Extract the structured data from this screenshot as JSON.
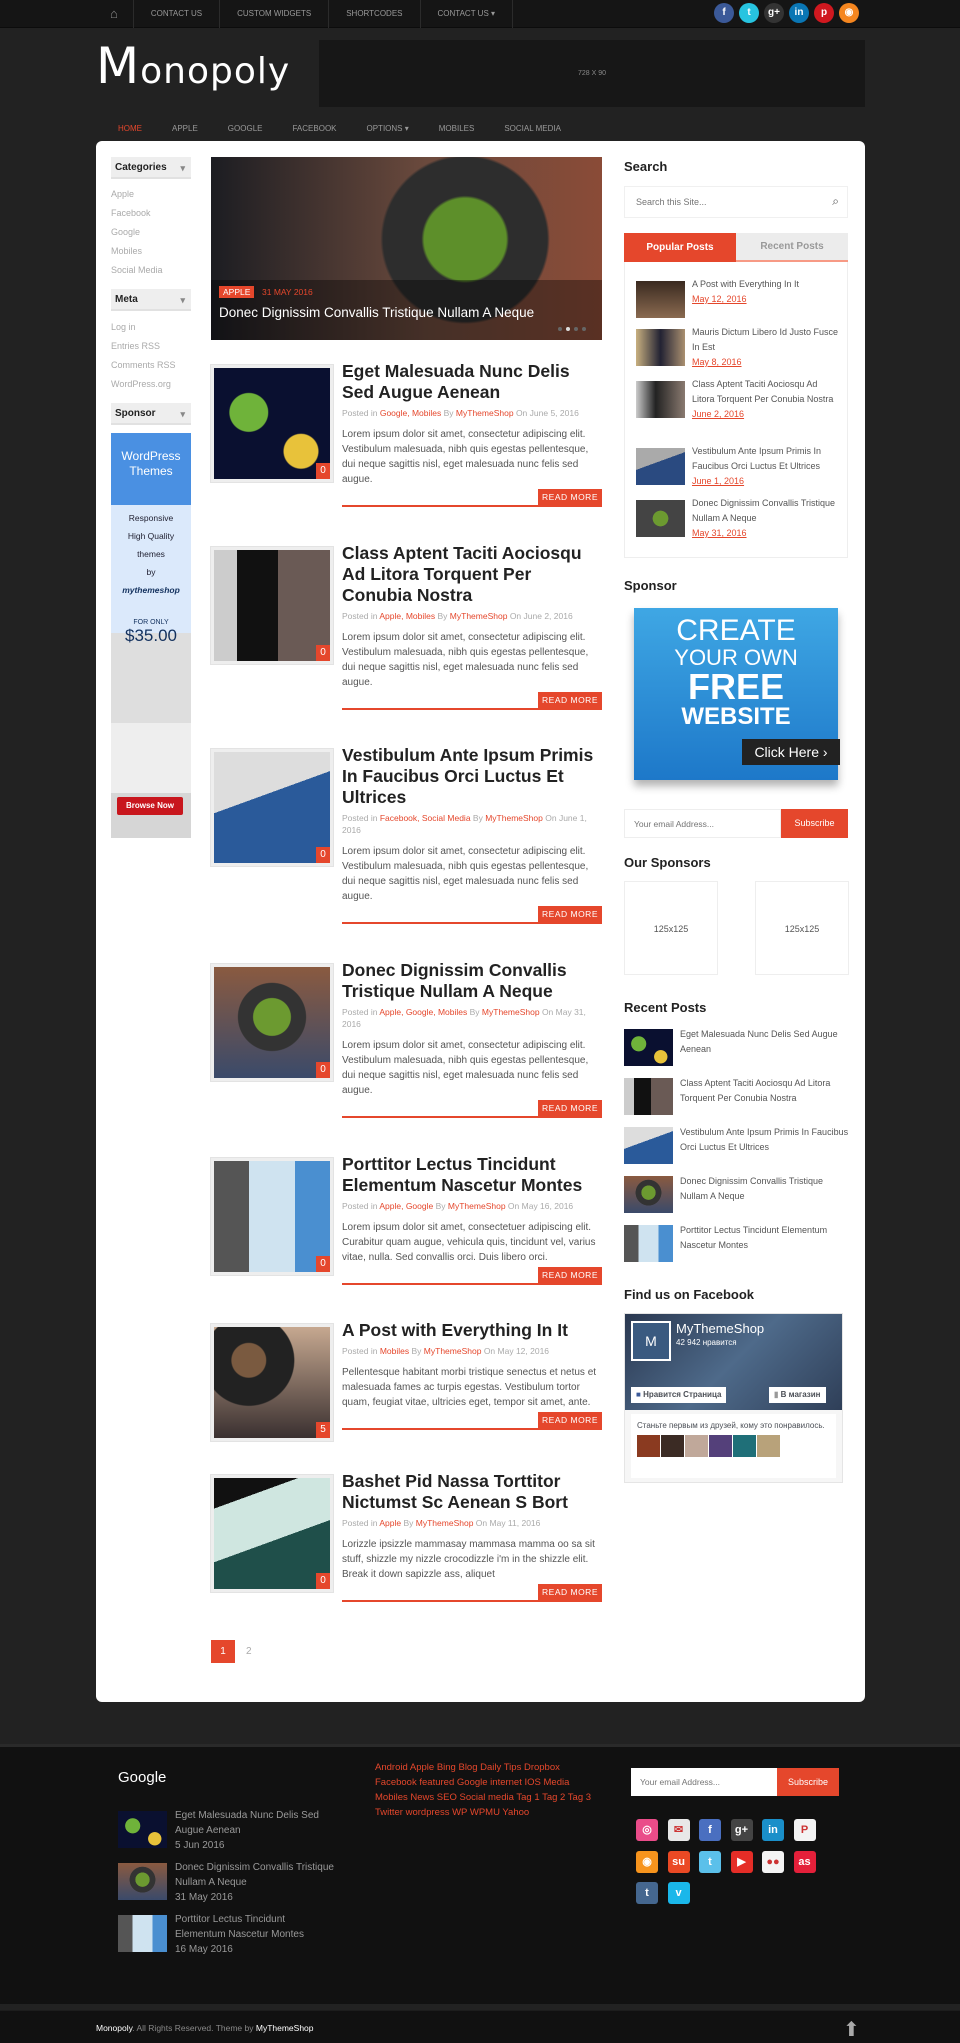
{
  "topbar": {
    "nav": [
      "CONTACT US",
      "CUSTOM WIDGETS",
      "SHORTCODES",
      "CONTACT US ▾"
    ],
    "social": [
      {
        "icon": "facebook-icon",
        "glyph": "f",
        "color": "#3b5998"
      },
      {
        "icon": "twitter-icon",
        "glyph": "t",
        "color": "#27c4e0"
      },
      {
        "icon": "google-plus-icon",
        "glyph": "g+",
        "color": "#333"
      },
      {
        "icon": "linkedin-icon",
        "glyph": "in",
        "color": "#0a76b4"
      },
      {
        "icon": "pinterest-icon",
        "glyph": "p",
        "color": "#d0181f"
      },
      {
        "icon": "rss-icon",
        "glyph": "◉",
        "color": "#f5861f"
      }
    ]
  },
  "header": {
    "logo_first": "M",
    "logo_rest": "onopoly",
    "ad": "728 X 90"
  },
  "mainnav": [
    "HOME",
    "APPLE",
    "GOOGLE",
    "FACEBOOK",
    "OPTIONS ▾",
    "MOBILES",
    "SOCIAL MEDIA"
  ],
  "left": {
    "categories_title": "Categories",
    "categories": [
      "Apple",
      "Facebook",
      "Google",
      "Mobiles",
      "Social Media"
    ],
    "meta_title": "Meta",
    "meta": [
      "Log in",
      "Entries RSS",
      "Comments RSS",
      "WordPress.org"
    ],
    "sponsor_title": "Sponsor",
    "banner": {
      "l1": "WordPress",
      "l2": "Themes",
      "l3": "Responsive",
      "l4": "High Quality",
      "l5": "themes",
      "l6": "by",
      "l7": "mythemeshop",
      "l8": "FOR ONLY",
      "l9": "$35.00",
      "l10": "Browse Now"
    }
  },
  "slider": {
    "category": "APPLE",
    "date": "31 MAY 2016",
    "title": "Donec Dignissim Convallis Tristique Nullam A Neque"
  },
  "posts": [
    {
      "title": "Eget Malesuada Nunc Delis Sed Augue Aenean",
      "cats": "Google, Mobiles",
      "author": "MyThemeShop",
      "date": "June 5, 2016",
      "excerpt": "Lorem ipsum dolor sit amet, consectetur adipiscing elit. Vestibulum malesuada, nibh quis egestas pellentesque, dui neque sagittis nisl, eget malesuada nunc felis sed augue.",
      "comments": "0"
    },
    {
      "title": "Class Aptent Taciti Aociosqu Ad Litora Torquent Per Conubia Nostra",
      "cats": "Apple, Mobiles",
      "author": "MyThemeShop",
      "date": "June 2, 2016",
      "excerpt": "Lorem ipsum dolor sit amet, consectetur adipiscing elit. Vestibulum malesuada, nibh quis egestas pellentesque, dui neque sagittis nisl, eget malesuada nunc felis sed augue.",
      "comments": "0"
    },
    {
      "title": "Vestibulum Ante Ipsum Primis In Faucibus Orci Luctus Et Ultrices",
      "cats": "Facebook, Social Media",
      "author": "MyThemeShop",
      "date": "June 1, 2016",
      "excerpt": "Lorem ipsum dolor sit amet, consectetur adipiscing elit. Vestibulum malesuada, nibh quis egestas pellentesque, dui neque sagittis nisl, eget malesuada nunc felis sed augue.",
      "comments": "0"
    },
    {
      "title": "Donec Dignissim Convallis Tristique Nullam A Neque",
      "cats": "Apple, Google, Mobiles",
      "author": "MyThemeShop",
      "date": "May 31, 2016",
      "excerpt": "Lorem ipsum dolor sit amet, consectetur adipiscing elit. Vestibulum malesuada, nibh quis egestas pellentesque, dui neque sagittis nisl, eget malesuada nunc felis sed augue.",
      "comments": "0"
    },
    {
      "title": "Porttitor Lectus Tincidunt Elementum Nascetur Montes",
      "cats": "Apple, Google",
      "author": "MyThemeShop",
      "date": "May 16, 2016",
      "excerpt": "Lorem ipsum dolor sit amet, consectetuer adipiscing elit. Curabitur quam augue, vehicula quis, tincidunt vel, varius vitae, nulla. Sed convallis orci. Duis libero orci.",
      "comments": "0"
    },
    {
      "title": "A Post with Everything In It",
      "cats": "Mobiles",
      "author": "MyThemeShop",
      "date": "May 12, 2016",
      "excerpt": "Pellentesque habitant morbi tristique senectus et netus et malesuada fames ac turpis egestas. Vestibulum tortor quam, feugiat vitae, ultricies eget, tempor sit amet, ante.",
      "comments": "5"
    },
    {
      "title": "Bashet Pid Nassa Torttitor Nictumst Sc Aenean S Bort",
      "cats": "Apple",
      "author": "MyThemeShop",
      "date": "May 11, 2016",
      "excerpt": "Lorizzle ipsizzle mammasay mammasa mamma oo sa sit stuff, shizzle my nizzle crocodizzle i'm in the shizzle elit. Break it down sapizzle ass, aliquet",
      "comments": "0"
    }
  ],
  "post_labels": {
    "posted_in": "Posted in",
    "by": "By",
    "on": "On",
    "read_more": "READ MORE"
  },
  "pagination": [
    "1",
    "2"
  ],
  "right": {
    "search_title": "Search",
    "search_placeholder": "Search this Site...",
    "tab_popular": "Popular Posts",
    "tab_recent": "Recent Posts",
    "popular": [
      {
        "title": "A Post with Everything In It",
        "date": "May 12, 2016"
      },
      {
        "title": "Mauris Dictum Libero Id Justo Fusce In Est",
        "date": "May 8, 2016"
      },
      {
        "title": "Class Aptent Taciti Aociosqu Ad Litora Torquent Per Conubia Nostra",
        "date": "June 2, 2016"
      },
      {
        "title": "Vestibulum Ante Ipsum Primis In Faucibus Orci Luctus Et Ultrices",
        "date": "June 1, 2016"
      },
      {
        "title": "Donec Dignissim Convallis Tristique Nullam A Neque",
        "date": "May 31, 2016"
      }
    ],
    "sponsor_title": "Sponsor",
    "sponsor_banner": {
      "l1": "CREATE",
      "l2": "YOUR OWN",
      "l3": "FREE",
      "l4": "WEBSITE",
      "l5": "Click Here ›"
    },
    "email_placeholder": "Your email Address...",
    "subscribe": "Subscribe",
    "our_sponsors": "Our Sponsors",
    "box": "125x125",
    "recent_title": "Recent Posts",
    "recent": [
      "Eget Malesuada Nunc Delis Sed Augue Aenean",
      "Class Aptent Taciti Aociosqu Ad Litora Torquent Per Conubia Nostra",
      "Vestibulum Ante Ipsum Primis In Faucibus Orci Luctus Et Ultrices",
      "Donec Dignissim Convallis Tristique Nullam A Neque",
      "Porttitor Lectus Tincidunt Elementum Nascetur Montes"
    ],
    "fb_title": "Find us on Facebook",
    "fb": {
      "name": "MyThemeShop",
      "likes": "42 942 нравится",
      "like_btn": "Нравится Страница",
      "shop_btn": "В магазин",
      "friends": "Станьте первым из друзей, кому это понравилось."
    }
  },
  "footer": {
    "google_title": "Google",
    "google_posts": [
      {
        "title": "Eget Malesuada Nunc Delis Sed Augue Aenean",
        "date": "5 Jun 2016"
      },
      {
        "title": "Donec Dignissim Convallis Tristique Nullam A Neque",
        "date": "31 May 2016"
      },
      {
        "title": "Porttitor Lectus Tincidunt Elementum Nascetur Montes",
        "date": "16 May 2016"
      }
    ],
    "tags": [
      "Android",
      "Apple",
      "Bing",
      "Blog",
      "Daily Tips",
      "Dropbox",
      "Facebook",
      "featured",
      "Google",
      "internet",
      "IOS",
      "Media",
      "Mobiles",
      "News",
      "SEO",
      "Social media",
      "Tag 1",
      "Tag 2",
      "Tag 3",
      "Twitter",
      "wordpress",
      "WP",
      "WPMU",
      "Yahoo"
    ],
    "email_placeholder": "Your email Address...",
    "subscribe": "Subscribe",
    "social": [
      {
        "icon": "dribbble-icon",
        "glyph": "◎",
        "color": "#ea4c89"
      },
      {
        "icon": "email-icon",
        "glyph": "✉",
        "color": "#e8e8e8"
      },
      {
        "icon": "facebook-icon",
        "glyph": "f",
        "color": "#4a6fc0"
      },
      {
        "icon": "google-plus-icon",
        "glyph": "g+",
        "color": "#444"
      },
      {
        "icon": "linkedin-icon",
        "glyph": "in",
        "color": "#1a8fc9"
      },
      {
        "icon": "pinterest-icon",
        "glyph": "P",
        "color": "#f4f4f4"
      },
      {
        "icon": "rss-icon",
        "glyph": "◉",
        "color": "#f7941d"
      },
      {
        "icon": "stumbleupon-icon",
        "glyph": "su",
        "color": "#eb4924"
      },
      {
        "icon": "twitter-icon",
        "glyph": "t",
        "color": "#5bc0ea"
      },
      {
        "icon": "youtube-icon",
        "glyph": "▶",
        "color": "#e52d27"
      },
      {
        "icon": "flickr-icon",
        "glyph": "●●",
        "color": "#f4f4f4"
      },
      {
        "icon": "lastfm-icon",
        "glyph": "as",
        "color": "#e4203a"
      },
      {
        "icon": "tumblr-icon",
        "glyph": "t",
        "color": "#45678f"
      },
      {
        "icon": "vimeo-icon",
        "glyph": "v",
        "color": "#1ab7ea"
      }
    ],
    "copyright_site": "Monopoly",
    "copyright_text": ". All Rights Reserved. Theme by ",
    "copyright_link": "MyThemeShop"
  },
  "colors": {
    "accent": "#e5472c",
    "page_bg": "#222222",
    "footer_bg": "#111111"
  }
}
